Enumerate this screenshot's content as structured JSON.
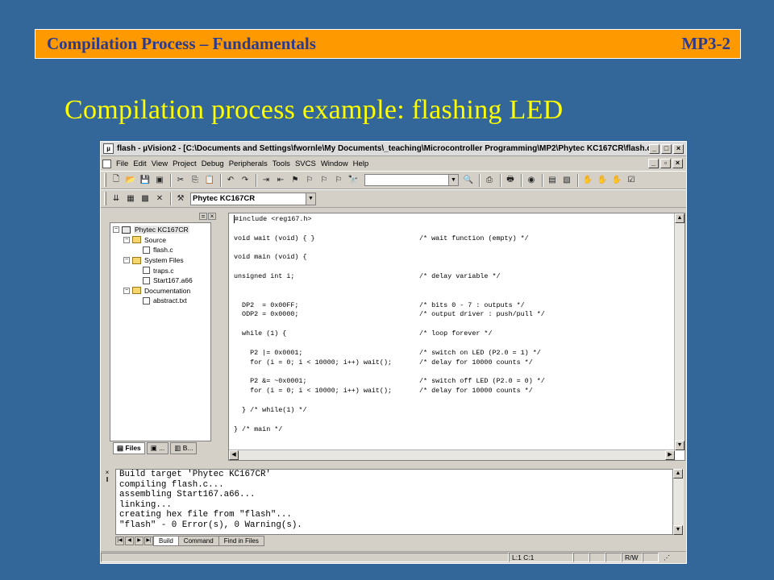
{
  "slide": {
    "header_title": "Compilation Process – Fundamentals",
    "header_code": "MP3-2",
    "title": "Compilation process example: flashing LED",
    "colors": {
      "background": "#336699",
      "header_bar": "#ff9900",
      "title": "#ffff00"
    }
  },
  "window": {
    "title": "flash - µVision2 - [C:\\Documents and Settings\\fwornle\\My Documents\\_teaching\\Microcontroller Programming\\MP2\\Phytec KC167CR\\flash.c]",
    "controls": [
      "_",
      "□",
      "×"
    ]
  },
  "menu": [
    "File",
    "Edit",
    "View",
    "Project",
    "Debug",
    "Peripherals",
    "Tools",
    "SVCS",
    "Window",
    "Help"
  ],
  "toolbar": {
    "search_value": "",
    "target_combo": "Phytec KC167CR"
  },
  "project": {
    "tree": [
      {
        "label": "Phytec KC167CR",
        "level": 0,
        "kind": "target",
        "expander": "−"
      },
      {
        "label": "Source",
        "level": 1,
        "kind": "folder",
        "expander": "−"
      },
      {
        "label": "flash.c",
        "level": 2,
        "kind": "file",
        "expander": ""
      },
      {
        "label": "System Files",
        "level": 1,
        "kind": "folder",
        "expander": "−"
      },
      {
        "label": "traps.c",
        "level": 2,
        "kind": "file",
        "expander": ""
      },
      {
        "label": "Start167.a66",
        "level": 2,
        "kind": "file",
        "expander": ""
      },
      {
        "label": "Documentation",
        "level": 1,
        "kind": "folder",
        "expander": "−"
      },
      {
        "label": "abstract.txt",
        "level": 2,
        "kind": "file",
        "expander": ""
      }
    ],
    "tabs": [
      "Files",
      "...",
      "B..."
    ]
  },
  "editor": {
    "lines": [
      {
        "code": "#include <reg167.h>",
        "comment": ""
      },
      {
        "code": "",
        "comment": ""
      },
      {
        "code": "void wait (void) { }",
        "comment": "/* wait function (empty) */"
      },
      {
        "code": "",
        "comment": ""
      },
      {
        "code": "void main (void) {",
        "comment": ""
      },
      {
        "code": "",
        "comment": ""
      },
      {
        "code": "unsigned int i;",
        "comment": "/* delay variable */"
      },
      {
        "code": "",
        "comment": ""
      },
      {
        "code": "",
        "comment": ""
      },
      {
        "code": "  DP2  = 0x00FF;",
        "comment": "/* bits 0 - 7 : outputs */"
      },
      {
        "code": "  ODP2 = 0x0000;",
        "comment": "/* output driver : push/pull */"
      },
      {
        "code": "",
        "comment": ""
      },
      {
        "code": "  while (1) {",
        "comment": "/* loop forever */"
      },
      {
        "code": "",
        "comment": ""
      },
      {
        "code": "    P2 |= 0x0001;",
        "comment": "/* switch on LED (P2.0 = 1) */"
      },
      {
        "code": "    for (i = 0; i < 10000; i++) wait();",
        "comment": "/* delay for 10000 counts */"
      },
      {
        "code": "",
        "comment": ""
      },
      {
        "code": "    P2 &= ~0x0001;",
        "comment": "/* switch off LED (P2.0 = 0) */"
      },
      {
        "code": "    for (i = 0; i < 10000; i++) wait();",
        "comment": "/* delay for 10000 counts */"
      },
      {
        "code": "",
        "comment": ""
      },
      {
        "code": "  } /* while(1) */",
        "comment": ""
      },
      {
        "code": "",
        "comment": ""
      },
      {
        "code": "} /* main */",
        "comment": ""
      }
    ]
  },
  "output": {
    "lines": [
      "Build target 'Phytec KC167CR'",
      "compiling flash.c...",
      "assembling Start167.a66...",
      "linking...",
      "creating hex file from \"flash\"...",
      "\"flash\" - 0 Error(s), 0 Warning(s)."
    ],
    "tabs": [
      "Build",
      "Command",
      "Find in Files"
    ]
  },
  "status": {
    "position": "L:1 C:1",
    "mode": "R/W"
  }
}
